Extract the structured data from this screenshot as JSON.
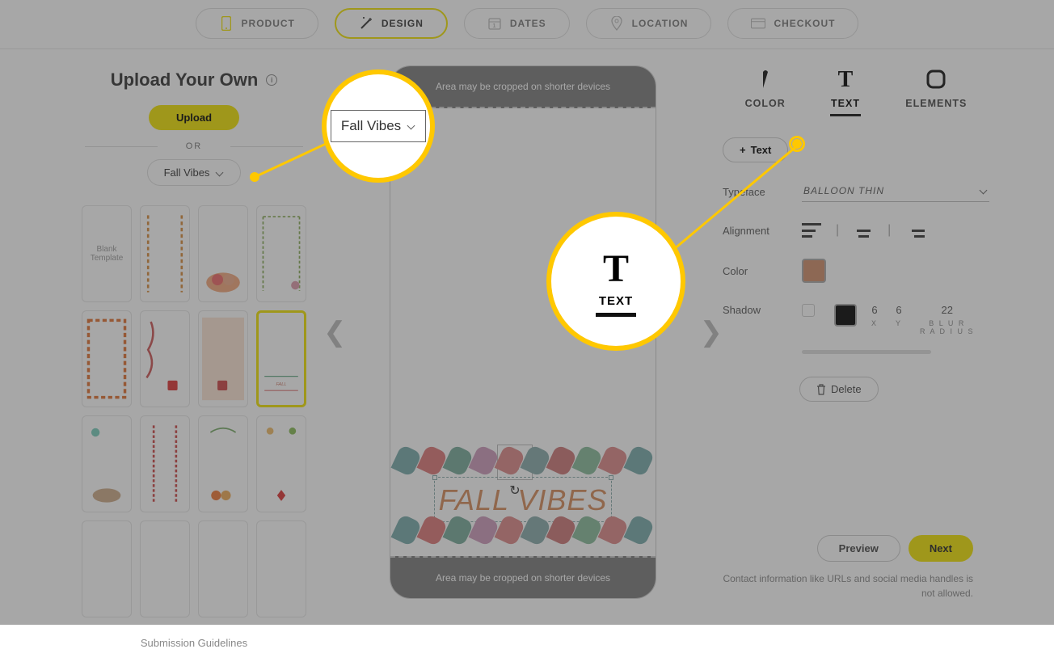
{
  "steps": {
    "product": "PRODUCT",
    "design": "DESIGN",
    "dates": "DATES",
    "location": "LOCATION",
    "checkout": "CHECKOUT"
  },
  "left": {
    "title": "Upload Your Own",
    "upload": "Upload",
    "or": "OR",
    "theme": "Fall Vibes",
    "blank": "Blank Template",
    "guidelines": "Submission Guidelines"
  },
  "preview": {
    "crop_top": "Area may be cropped on shorter devices",
    "crop_bot": "Area may be cropped on shorter devices",
    "text": "FALL VIBES"
  },
  "right": {
    "tabs": {
      "color": "COLOR",
      "text": "TEXT",
      "elements": "ELEMENTS"
    },
    "add_text": "Text",
    "typeface_label": "Typeface",
    "typeface_value": "BALLOON THIN",
    "alignment_label": "Alignment",
    "color_label": "Color",
    "color_value": "#cf8c68",
    "shadow_label": "Shadow",
    "shadow": {
      "x": "6",
      "y": "6",
      "blur": "22",
      "x_l": "X",
      "y_l": "Y",
      "blur_l": "B L U R\nR A D I U S"
    },
    "delete": "Delete"
  },
  "foot": {
    "preview": "Preview",
    "next": "Next",
    "note": "Contact information like URLs and social media handles is not allowed."
  },
  "callout1": "Fall Vibes",
  "callout2": "TEXT"
}
